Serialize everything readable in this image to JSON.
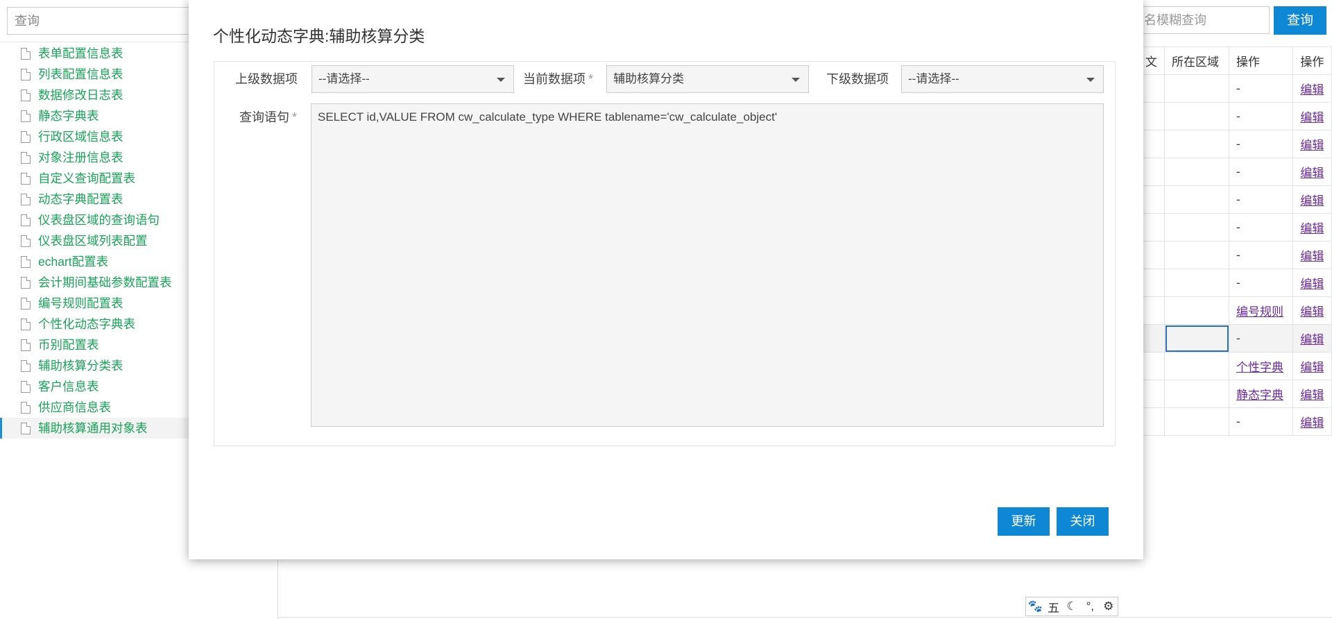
{
  "sidebar": {
    "search_placeholder": "查询",
    "items": [
      {
        "label": "表单配置信息表"
      },
      {
        "label": "列表配置信息表"
      },
      {
        "label": "数据修改日志表"
      },
      {
        "label": "静态字典表"
      },
      {
        "label": "行政区域信息表"
      },
      {
        "label": "对象注册信息表"
      },
      {
        "label": "自定义查询配置表"
      },
      {
        "label": "动态字典配置表"
      },
      {
        "label": "仪表盘区域的查询语句"
      },
      {
        "label": "仪表盘区域列表配置"
      },
      {
        "label": "echart配置表"
      },
      {
        "label": "会计期间基础参数配置表"
      },
      {
        "label": "编号规则配置表"
      },
      {
        "label": "个性化动态字典表"
      },
      {
        "label": "币别配置表"
      },
      {
        "label": "辅助核算分类表"
      },
      {
        "label": "客户信息表"
      },
      {
        "label": "供应商信息表"
      },
      {
        "label": "辅助核算通用对象表"
      }
    ],
    "active_index": 18
  },
  "background": {
    "search_placeholder": "文名模糊查询",
    "query_button": "查询",
    "table": {
      "headers": [
        "文",
        "所在区域",
        "操作",
        "操作"
      ],
      "rows": [
        {
          "area": "",
          "op": "-",
          "edit": "编辑"
        },
        {
          "area": "",
          "op": "-",
          "edit": "编辑"
        },
        {
          "area": "",
          "op": "-",
          "edit": "编辑"
        },
        {
          "area": "",
          "op": "-",
          "edit": "编辑"
        },
        {
          "area": "",
          "op": "-",
          "edit": "编辑"
        },
        {
          "area": "",
          "op": "-",
          "edit": "编辑"
        },
        {
          "area": "",
          "op": "-",
          "edit": "编辑"
        },
        {
          "area": "",
          "op": "-",
          "edit": "编辑"
        },
        {
          "area": "",
          "op": "编号规则",
          "edit": "编辑"
        },
        {
          "area": "",
          "op": "-",
          "edit": "编辑"
        },
        {
          "area": "",
          "op": "个性字典",
          "edit": "编辑"
        },
        {
          "area": "",
          "op": "静态字典",
          "edit": "编辑"
        },
        {
          "area": "",
          "op": "-",
          "edit": "编辑"
        }
      ]
    }
  },
  "modal": {
    "title": "个性化动态字典:辅助核算分类",
    "parent_label": "上级数据项",
    "parent_value": "--请选择--",
    "current_label": "当前数据项",
    "current_required": "*",
    "current_value": "辅助核算分类",
    "child_label": "下级数据项",
    "child_value": "--请选择--",
    "query_label": "查询语句",
    "query_required": "*",
    "query_value": "SELECT id,VALUE FROM cw_calculate_type WHERE tablename='cw_calculate_object'",
    "update_button": "更新",
    "close_button": "关闭"
  },
  "ime": {
    "mode_label": "五"
  }
}
